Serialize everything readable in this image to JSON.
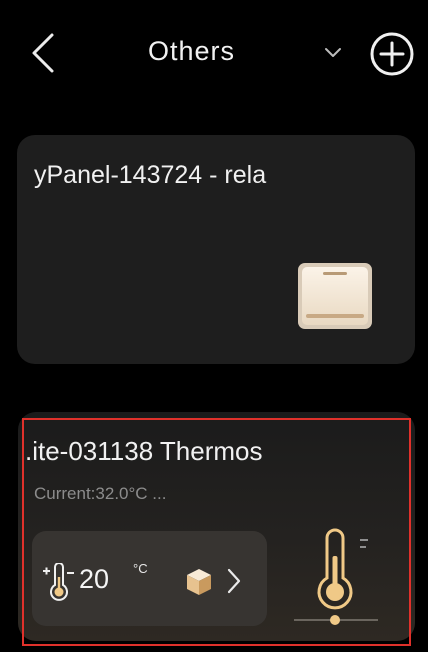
{
  "header": {
    "title": "Others",
    "back_icon": "chevron-left-icon",
    "dropdown_icon": "chevron-down-icon",
    "add_icon": "add-circle-icon"
  },
  "devices": [
    {
      "name": "yPanel-143724 - rela",
      "icon": "wall-switch-icon"
    },
    {
      "name": ".ite-031138 Thermos",
      "status": "Current:32.0°C ...",
      "setpoint": "20",
      "unit": "°C",
      "control_icons": [
        "thermometer-adjust-icon",
        "mode-cube-icon",
        "chevron-right-icon"
      ],
      "icon": "thermometer-icon",
      "selected": true
    }
  ],
  "colors": {
    "background": "#000000",
    "card": "#1e1e1e",
    "selection_outline": "#e0312b",
    "accent_gold": "#f0c987"
  }
}
